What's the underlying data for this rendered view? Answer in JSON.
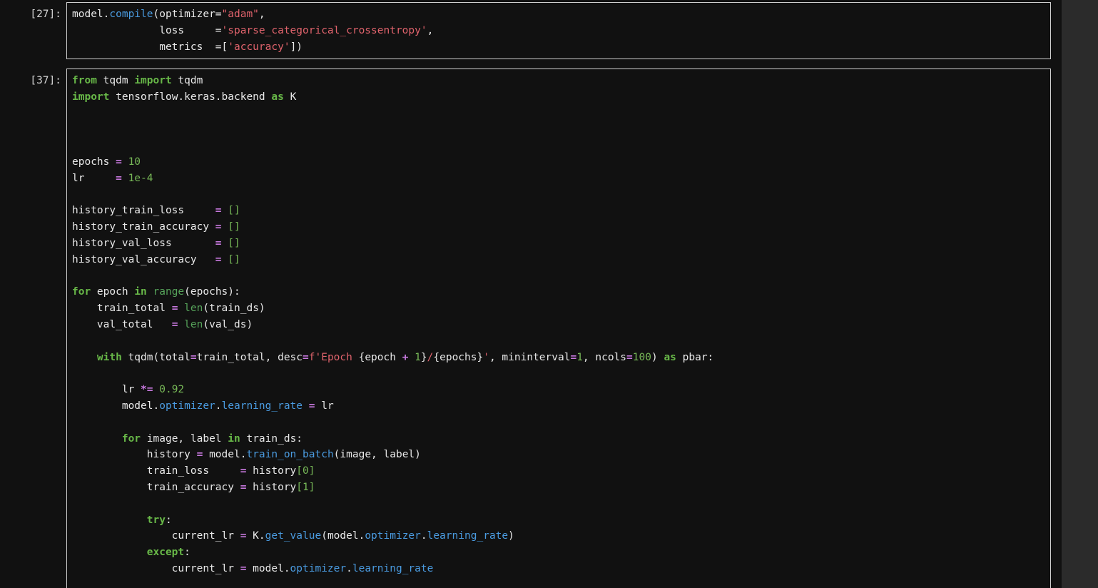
{
  "cells": [
    {
      "prompt": "[27]:",
      "lines": [
        [
          [
            "plain",
            "model."
          ],
          [
            "attr",
            "compile"
          ],
          [
            "plain",
            "(optimizer="
          ],
          [
            "str",
            "\"adam\""
          ],
          [
            "plain",
            ","
          ]
        ],
        [
          [
            "plain",
            "              loss     ="
          ],
          [
            "str",
            "'sparse_categorical_crossentropy'"
          ],
          [
            "plain",
            ","
          ]
        ],
        [
          [
            "plain",
            "              metrics  ="
          ],
          [
            "plain",
            "["
          ],
          [
            "str",
            "'accuracy'"
          ],
          [
            "plain",
            "])"
          ]
        ]
      ]
    },
    {
      "prompt": "[37]:",
      "lines": [
        [
          [
            "kw",
            "from"
          ],
          [
            "plain",
            " tqdm "
          ],
          [
            "kw",
            "import"
          ],
          [
            "plain",
            " tqdm"
          ]
        ],
        [
          [
            "kw",
            "import"
          ],
          [
            "plain",
            " tensorflow.keras.backend "
          ],
          [
            "kw",
            "as"
          ],
          [
            "plain",
            " K"
          ]
        ],
        [],
        [],
        [],
        [
          [
            "plain",
            "epochs "
          ],
          [
            "op",
            "="
          ],
          [
            "plain",
            " "
          ],
          [
            "num",
            "10"
          ]
        ],
        [
          [
            "plain",
            "lr     "
          ],
          [
            "op",
            "="
          ],
          [
            "plain",
            " "
          ],
          [
            "num",
            "1e-4"
          ]
        ],
        [],
        [
          [
            "plain",
            "history_train_loss     "
          ],
          [
            "op",
            "="
          ],
          [
            "plain",
            " "
          ],
          [
            "num",
            "[]"
          ]
        ],
        [
          [
            "plain",
            "history_train_accuracy "
          ],
          [
            "op",
            "="
          ],
          [
            "plain",
            " "
          ],
          [
            "num",
            "[]"
          ]
        ],
        [
          [
            "plain",
            "history_val_loss       "
          ],
          [
            "op",
            "="
          ],
          [
            "plain",
            " "
          ],
          [
            "num",
            "[]"
          ]
        ],
        [
          [
            "plain",
            "history_val_accuracy   "
          ],
          [
            "op",
            "="
          ],
          [
            "plain",
            " "
          ],
          [
            "num",
            "[]"
          ]
        ],
        [],
        [
          [
            "kw",
            "for"
          ],
          [
            "plain",
            " epoch "
          ],
          [
            "kw",
            "in"
          ],
          [
            "plain",
            " "
          ],
          [
            "bi",
            "range"
          ],
          [
            "plain",
            "(epochs):"
          ]
        ],
        [
          [
            "plain",
            "    train_total "
          ],
          [
            "op",
            "="
          ],
          [
            "plain",
            " "
          ],
          [
            "bi",
            "len"
          ],
          [
            "plain",
            "(train_ds)"
          ]
        ],
        [
          [
            "plain",
            "    val_total   "
          ],
          [
            "op",
            "="
          ],
          [
            "plain",
            " "
          ],
          [
            "bi",
            "len"
          ],
          [
            "plain",
            "(val_ds)"
          ]
        ],
        [],
        [
          [
            "plain",
            "    "
          ],
          [
            "kw",
            "with"
          ],
          [
            "plain",
            " tqdm(total"
          ],
          [
            "op",
            "="
          ],
          [
            "plain",
            "train_total, desc"
          ],
          [
            "op",
            "="
          ],
          [
            "str",
            "f'Epoch "
          ],
          [
            "plain",
            "{epoch "
          ],
          [
            "op",
            "+"
          ],
          [
            "plain",
            " "
          ],
          [
            "num",
            "1"
          ],
          [
            "plain",
            "}"
          ],
          [
            "str",
            "/"
          ],
          [
            "plain",
            "{epochs}"
          ],
          [
            "str",
            "'"
          ],
          [
            "plain",
            ", mininterval"
          ],
          [
            "op",
            "="
          ],
          [
            "num",
            "1"
          ],
          [
            "plain",
            ", ncols"
          ],
          [
            "op",
            "="
          ],
          [
            "num",
            "100"
          ],
          [
            "plain",
            ") "
          ],
          [
            "kw",
            "as"
          ],
          [
            "plain",
            " pbar:"
          ]
        ],
        [],
        [
          [
            "plain",
            "        lr "
          ],
          [
            "op",
            "*="
          ],
          [
            "plain",
            " "
          ],
          [
            "num",
            "0.92"
          ]
        ],
        [
          [
            "plain",
            "        model."
          ],
          [
            "attr",
            "optimizer"
          ],
          [
            "plain",
            "."
          ],
          [
            "attr",
            "learning_rate"
          ],
          [
            "plain",
            " "
          ],
          [
            "op",
            "="
          ],
          [
            "plain",
            " lr"
          ]
        ],
        [],
        [
          [
            "plain",
            "        "
          ],
          [
            "kw",
            "for"
          ],
          [
            "plain",
            " image, label "
          ],
          [
            "kw",
            "in"
          ],
          [
            "plain",
            " train_ds:"
          ]
        ],
        [
          [
            "plain",
            "            history "
          ],
          [
            "op",
            "="
          ],
          [
            "plain",
            " model."
          ],
          [
            "attr",
            "train_on_batch"
          ],
          [
            "plain",
            "(image, label)"
          ]
        ],
        [
          [
            "plain",
            "            train_loss     "
          ],
          [
            "op",
            "="
          ],
          [
            "plain",
            " history"
          ],
          [
            "idx",
            "[0]"
          ]
        ],
        [
          [
            "plain",
            "            train_accuracy "
          ],
          [
            "op",
            "="
          ],
          [
            "plain",
            " history"
          ],
          [
            "idx",
            "[1]"
          ]
        ],
        [],
        [
          [
            "plain",
            "            "
          ],
          [
            "kw",
            "try"
          ],
          [
            "plain",
            ":"
          ]
        ],
        [
          [
            "plain",
            "                current_lr "
          ],
          [
            "op",
            "="
          ],
          [
            "plain",
            " K."
          ],
          [
            "attr",
            "get_value"
          ],
          [
            "plain",
            "(model."
          ],
          [
            "attr",
            "optimizer"
          ],
          [
            "plain",
            "."
          ],
          [
            "attr",
            "learning_rate"
          ],
          [
            "plain",
            ")"
          ]
        ],
        [
          [
            "plain",
            "            "
          ],
          [
            "kw",
            "except"
          ],
          [
            "plain",
            ":"
          ]
        ],
        [
          [
            "plain",
            "                current_lr "
          ],
          [
            "op",
            "="
          ],
          [
            "plain",
            " model."
          ],
          [
            "attr",
            "optimizer"
          ],
          [
            "plain",
            "."
          ],
          [
            "attr",
            "learning_rate"
          ]
        ]
      ]
    }
  ]
}
